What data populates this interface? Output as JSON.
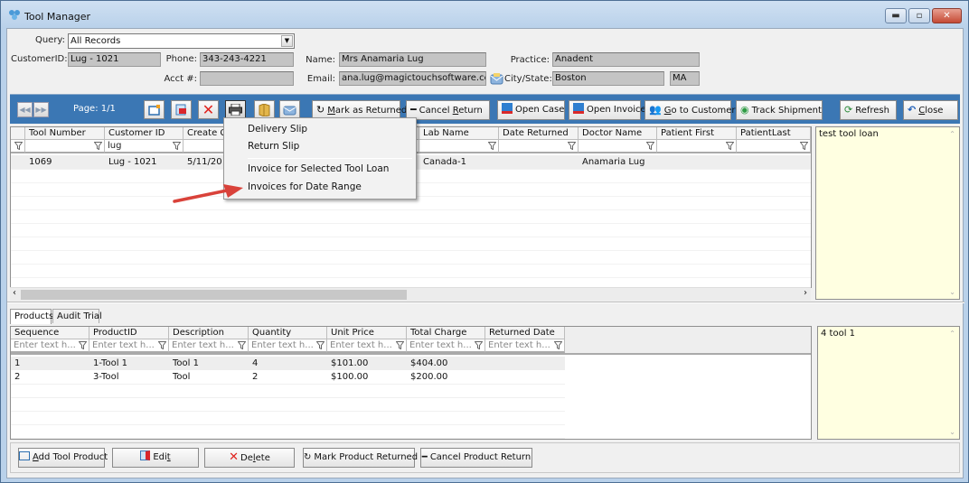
{
  "window": {
    "title": "Tool Manager",
    "icon": "tools-app-icon",
    "controls": {
      "minimize": "minimize-icon",
      "maximize": "maximize-icon",
      "close": "close-icon"
    }
  },
  "header": {
    "query_label": "Query:",
    "query_value": "All Records",
    "customer_id_label": "CustomerID:",
    "customer_id": "Lug - 1021",
    "phone_label": "Phone:",
    "phone": "343-243-4221",
    "acct_label": "Acct #:",
    "acct": "",
    "name_label": "Name:",
    "name": "Mrs Anamaria Lug",
    "email_label": "Email:",
    "email": "ana.lug@magictouchsoftware.com",
    "practice_label": "Practice:",
    "practice": "Anadent",
    "city_state_label": "City/State:",
    "city": "Boston",
    "state": "MA"
  },
  "toolbar": {
    "page_label": "Page: 1/1",
    "icons": [
      "first-page-icon",
      "next-page-icon",
      "new-icon",
      "edit-icon",
      "delete-icon",
      "print-icon",
      "book-icon",
      "email-icon"
    ],
    "mark_returned": {
      "pre": "",
      "ul": "M",
      "post": "ark as Returned"
    },
    "cancel_return": {
      "pre": "Cancel ",
      "ul": "R",
      "post": "eturn"
    },
    "open_case": "Open Case",
    "open_invoice": "Open Invoice",
    "go_to_customer": {
      "pre": "",
      "ul": "G",
      "post": "o to Customer"
    },
    "track_shipment": "Track Shipment",
    "refresh": "Refresh",
    "close": {
      "pre": "",
      "ul": "C",
      "post": "lose"
    }
  },
  "print_menu": {
    "items": [
      "Delivery Slip",
      "Return Slip",
      "Invoice for Selected Tool Loan",
      "Invoices for Date Range"
    ]
  },
  "loans_grid": {
    "columns": [
      "Tool Number",
      "Customer ID",
      "Create C",
      "",
      "",
      "Lab Name",
      "Date Returned",
      "Doctor Name",
      "Patient First",
      "PatientLast"
    ],
    "filters": [
      "",
      "lug",
      "",
      "",
      "",
      "",
      "",
      "",
      "",
      ""
    ],
    "rows": [
      [
        "1069",
        "Lug - 1021",
        "5/11/20",
        "",
        "",
        "Canada-1",
        "",
        "Anamaria Lug",
        "",
        ""
      ]
    ]
  },
  "loan_notes": "test tool loan",
  "tabs": [
    "Products",
    "Audit Trial"
  ],
  "products_grid": {
    "columns": [
      "Sequence",
      "ProductID",
      "Description",
      "Quantity",
      "Unit Price",
      "Total Charge",
      "Returned Date"
    ],
    "filter_placeholder": "Enter text h...",
    "rows": [
      [
        "1",
        "1-Tool 1",
        "Tool 1",
        "4",
        "$101.00",
        "$404.00",
        ""
      ],
      [
        "2",
        "3-Tool",
        "Tool",
        "2",
        "$100.00",
        "$200.00",
        ""
      ]
    ]
  },
  "product_notes": "4 tool 1",
  "bottom_buttons": {
    "add": {
      "pre": "",
      "ul": "A",
      "post": "dd Tool Product"
    },
    "edit": {
      "pre": "Edi",
      "ul": "t",
      "post": ""
    },
    "delete": {
      "pre": "De",
      "ul": "l",
      "post": "ete"
    },
    "mark_product_returned": "Mark Product Returned",
    "cancel_product_return": "Cancel Product Return"
  },
  "colors": {
    "toolbar_bg": "#3b77b4",
    "notes_bg": "#ffffe1",
    "annotation_arrow": "#d9423a"
  }
}
